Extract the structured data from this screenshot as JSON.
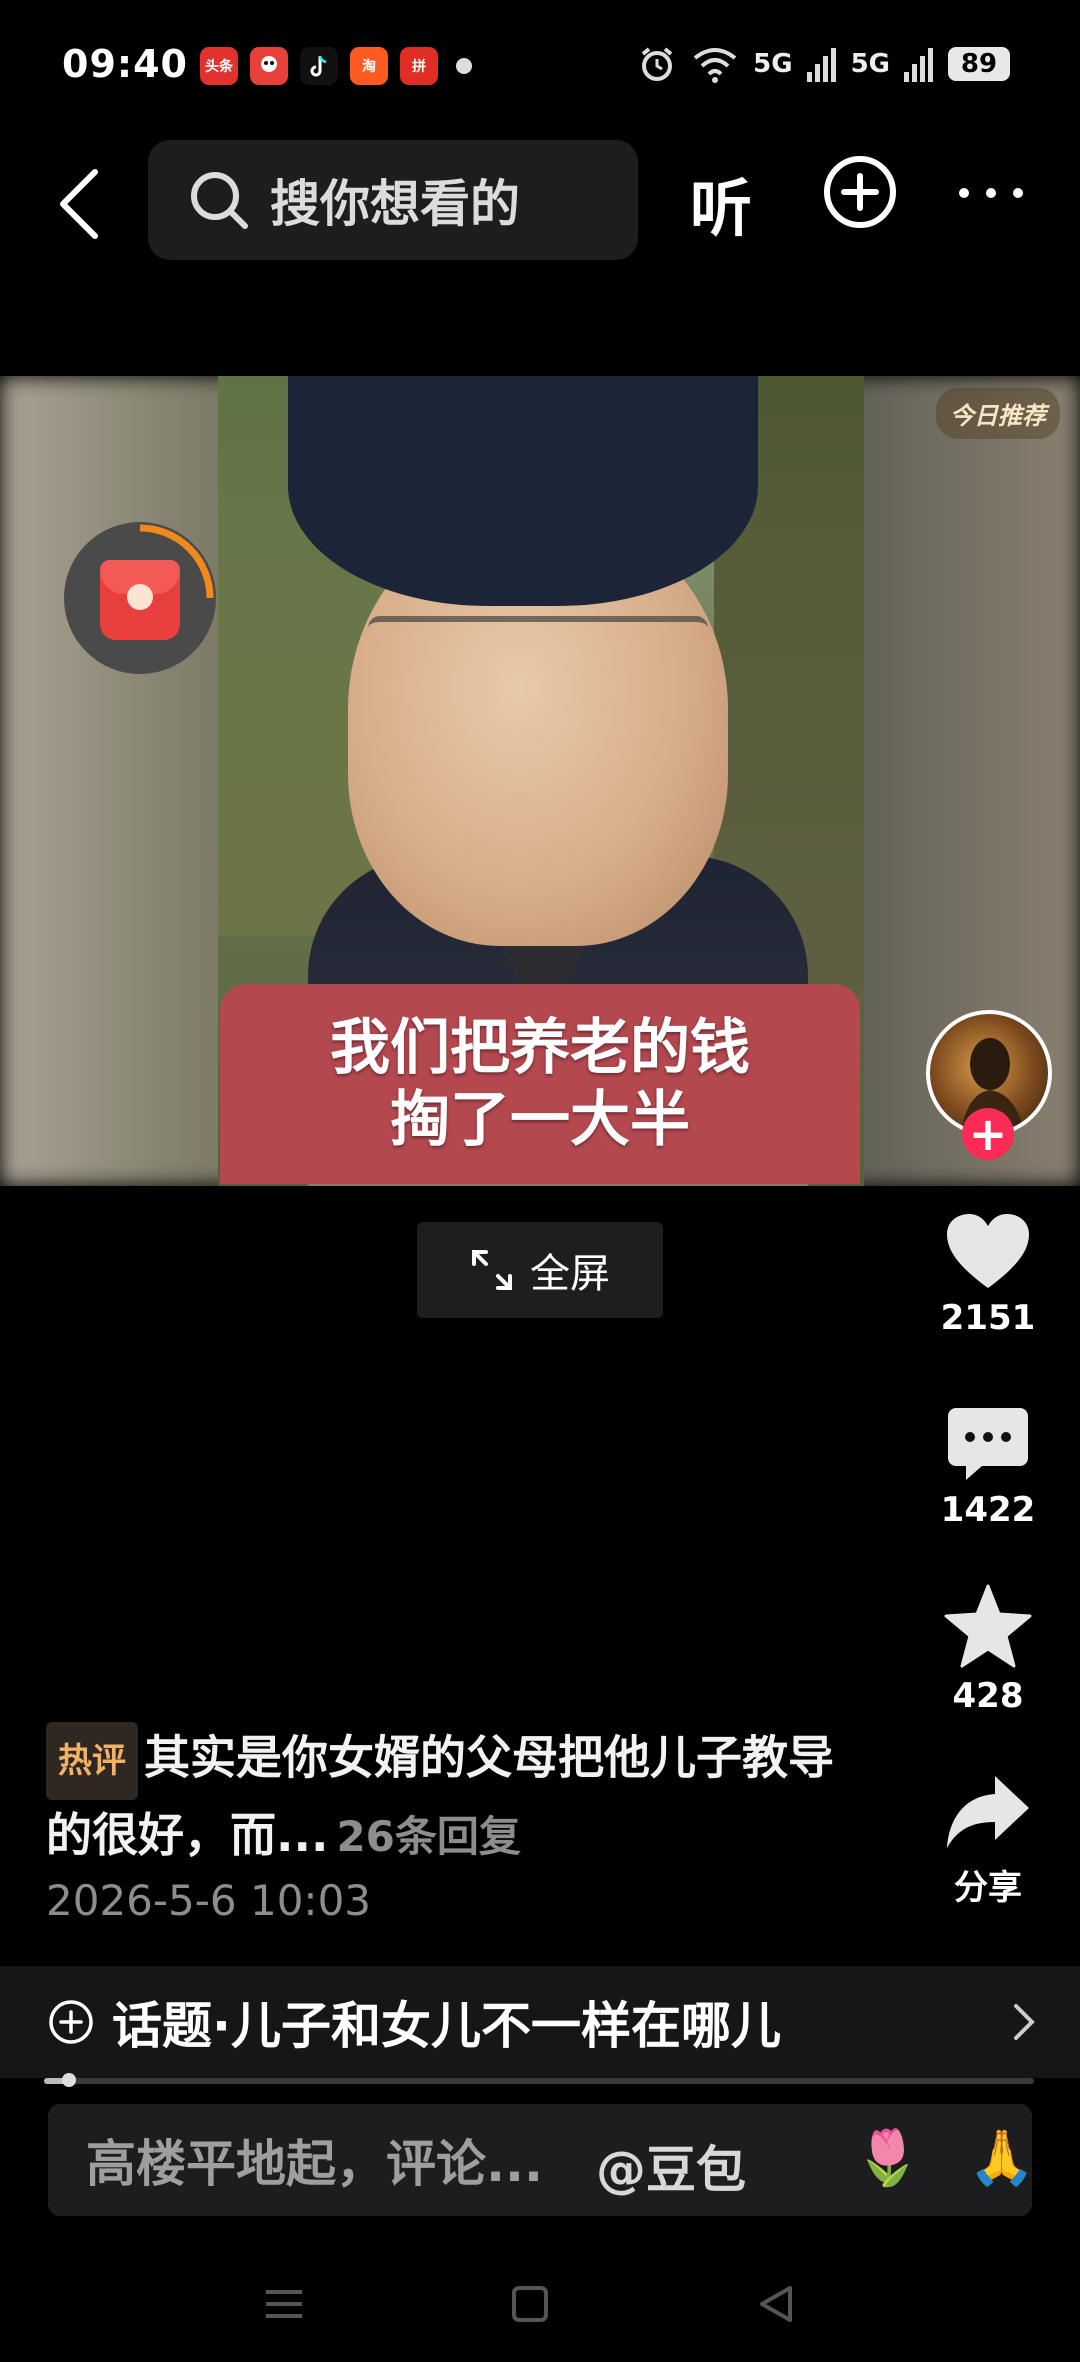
{
  "status_bar": {
    "time": "09:40",
    "notif_apps": [
      {
        "name": "头条",
        "color": "#e3312d"
      },
      {
        "name": "QQ",
        "color": "#e8413a"
      },
      {
        "name": "抖音",
        "color": "#111111"
      },
      {
        "name": "淘",
        "color": "#ff5a1f"
      },
      {
        "name": "拼",
        "color": "#e02e24"
      }
    ],
    "network_1": "5G",
    "network_2": "5G",
    "battery": "89"
  },
  "top_nav": {
    "search_placeholder": "搜你想看的",
    "listen_label": "听"
  },
  "video": {
    "caption_line_1": "我们把养老的钱",
    "caption_line_2": "掏了一大半",
    "badge": "今日推荐"
  },
  "actions": {
    "likes": "2151",
    "comments": "1422",
    "favorites": "428",
    "share_label": "分享"
  },
  "fullscreen_label": "全屏",
  "hot_comment": {
    "tag": "热评",
    "text": "其实是你女婿的父母把他儿子教导的很好，而...",
    "replies": "26条回复",
    "date": "2026-5-6 10:03"
  },
  "topic": {
    "label": "话题·儿子和女儿不一样在哪儿"
  },
  "progress": 0.025,
  "comment_input": {
    "placeholder": "高楼平地起，评论...",
    "mention": "@豆包",
    "emoji_1": "🌷",
    "emoji_2": "🙏"
  },
  "colors": {
    "accent_red": "#fa2b54",
    "hot_tag_text": "#f0b267",
    "caption_bg": "#b4484f"
  }
}
